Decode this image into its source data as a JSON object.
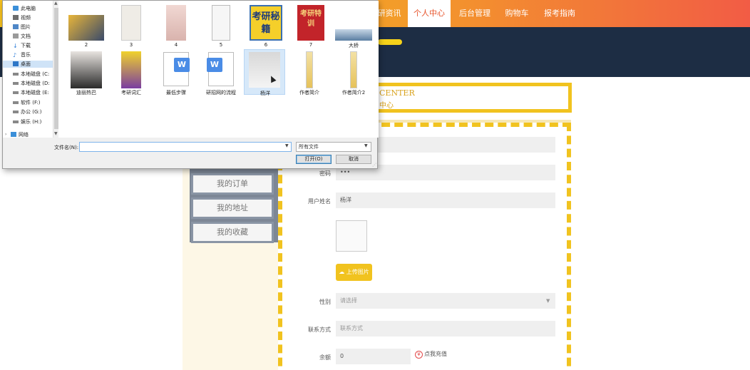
{
  "nav": {
    "items": [
      {
        "label": "研资讯",
        "active": false
      },
      {
        "label": "个人中心",
        "active": true
      },
      {
        "label": "后台管理",
        "active": false
      },
      {
        "label": "购物车",
        "active": false
      },
      {
        "label": "报考指南",
        "active": false
      }
    ]
  },
  "center_box": {
    "title": "CENTER",
    "subtitle": "中心"
  },
  "sidebar": {
    "items": [
      {
        "label": "我的订单"
      },
      {
        "label": "我的地址"
      },
      {
        "label": "我的收藏"
      }
    ]
  },
  "form": {
    "password_label": "密码",
    "password_value": "•••",
    "username_label": "用户姓名",
    "username_value": "杨洋",
    "upload_button": "上传图片",
    "gender_label": "性别",
    "gender_placeholder": "请选择",
    "contact_label": "联系方式",
    "contact_placeholder": "联系方式",
    "balance_label": "余额",
    "balance_value": "0",
    "recharge_label": "点我充值",
    "recharge_icon": "¥"
  },
  "dialog": {
    "tree": [
      {
        "label": "此电脑",
        "icon": "computer-icon",
        "selected": false
      },
      {
        "label": "视频",
        "icon": "video-folder-icon",
        "selected": false
      },
      {
        "label": "图片",
        "icon": "pictures-folder-icon",
        "selected": false
      },
      {
        "label": "文档",
        "icon": "documents-folder-icon",
        "selected": false
      },
      {
        "label": "下载",
        "icon": "download-icon",
        "selected": false
      },
      {
        "label": "音乐",
        "icon": "music-icon",
        "selected": false
      },
      {
        "label": "桌面",
        "icon": "desktop-folder-icon",
        "selected": true
      },
      {
        "label": "本地磁盘 (C:",
        "icon": "drive-icon",
        "selected": false
      },
      {
        "label": "本地磁盘 (D:",
        "icon": "drive-icon",
        "selected": false
      },
      {
        "label": "本地磁盘 (E:",
        "icon": "drive-icon",
        "selected": false
      },
      {
        "label": "软件 (F:)",
        "icon": "drive-icon",
        "selected": false
      },
      {
        "label": "办公 (G:)",
        "icon": "drive-icon",
        "selected": false
      },
      {
        "label": "娱乐 (H:)",
        "icon": "drive-icon",
        "selected": false
      },
      {
        "label": "网络",
        "icon": "network-icon",
        "selected": false
      }
    ],
    "files": [
      {
        "label": "2",
        "thumb": "book-photo"
      },
      {
        "label": "3",
        "thumb": "book-cover-white"
      },
      {
        "label": "4",
        "thumb": "book-cover-pink"
      },
      {
        "label": "5",
        "thumb": "phone-screenshot"
      },
      {
        "label": "6",
        "thumb": "yellow-book",
        "text": "考研秘籍"
      },
      {
        "label": "7",
        "thumb": "red-book",
        "text": "考研特训"
      },
      {
        "label": "大桥",
        "thumb": "bridge-photo"
      },
      {
        "label": "迪丽热巴",
        "thumb": "portrait-woman"
      },
      {
        "label": "考研词汇",
        "thumb": "purple-book"
      },
      {
        "label": "最低步骤",
        "thumb": "word-document"
      },
      {
        "label": "研招网的流程",
        "thumb": "word-document"
      },
      {
        "label": "杨洋",
        "thumb": "portrait-man",
        "selected": true
      },
      {
        "label": "作者简介",
        "thumb": "tall-strip"
      },
      {
        "label": "作者简介2",
        "thumb": "tall-strip"
      }
    ],
    "filename_label": "文件名(N):",
    "filename_value": "",
    "filetype_value": "所有文件",
    "open_button": "打开(O)",
    "cancel_button": "取消"
  },
  "colors": {
    "accent": "#f1c31f",
    "nav_red": "#f25c45",
    "banner": "#1d2d44"
  }
}
